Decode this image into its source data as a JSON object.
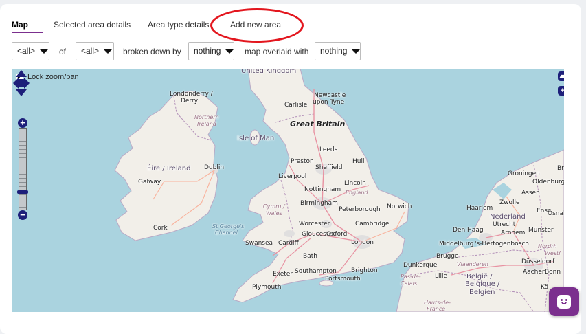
{
  "tabs": [
    {
      "label": "Map",
      "active": true
    },
    {
      "label": "Selected area details",
      "active": false
    },
    {
      "label": "Area type details",
      "active": false
    },
    {
      "label": "Add new area",
      "active": false,
      "highlighted": true
    }
  ],
  "controls": {
    "area_select": "<all>",
    "of_label": "of",
    "area_type_select": "<all>",
    "broken_down_label": "broken down by",
    "breakdown_select": "nothing",
    "overlay_label": "map overlaid with",
    "overlay_select": "nothing"
  },
  "map": {
    "lock_label": "Lock zoom/pan",
    "lock_checked": true,
    "zoom_level_fraction": 0.8,
    "labels": {
      "united_kingdom": "United Kingdom",
      "londonderry": "Londonderry /",
      "derry": "Derry",
      "northern": "Northern",
      "ireland_ni": "Ireland",
      "newcastle": "Newcastle",
      "upon_tyne": "upon Tyne",
      "carlisle": "Carlisle",
      "great_britain": "Great Britain",
      "isle_of_man": "Isle of Man",
      "leeds": "Leeds",
      "preston": "Preston",
      "hull": "Hull",
      "sheffield": "Sheffield",
      "eire": "Éire / Ireland",
      "dublin": "Dublin",
      "liverpool": "Liverpool",
      "galway": "Galway",
      "nottingham": "Nottingham",
      "lincoln": "Lincoln",
      "england": "England",
      "cymru": "Cymru /",
      "wales": "Wales",
      "birmingham": "Birmingham",
      "norwich": "Norwich",
      "peterborough": "Peterborough",
      "cork": "Cork",
      "st_georges": "St George's",
      "channel": "Channel",
      "worcester": "Worcester",
      "cambridge": "Cambridge",
      "gloucester": "Gloucester",
      "oxford": "Oxford",
      "swansea": "Swansea",
      "cardiff": "Cardiff",
      "london": "London",
      "bath": "Bath",
      "exeter": "Exeter",
      "southampton": "Southampton",
      "brighton": "Brighton",
      "plymouth": "Plymouth",
      "portsmouth": "Portsmouth",
      "dunkerque": "Dunkerque",
      "lille": "Lille",
      "pas_de": "Pas-de-",
      "calais": "Calais",
      "hauts_de": "Hauts-de-",
      "france": "France",
      "groningen": "Groningen",
      "oldenburg": "Oldenburg",
      "zwolle": "Zwolle",
      "haarlem": "Haarlem",
      "nederland": "Nederland",
      "den_haag": "Den Haag",
      "utrecht": "Utrecht",
      "arnhem": "Arnhem",
      "munster": "Münster",
      "middelburg": "Middelburg",
      "s_hertogenbosch": "'s-Hertogenbosch",
      "brugge": "Brugge",
      "vlaanderen": "Vlaanderen",
      "dusseldorf": "Düsseldorf",
      "aachen": "Aachen",
      "belgie": "België /",
      "belgique": "Belgique /",
      "belgien": "Belgien",
      "assen": "Assen",
      "enschede": "Ensc",
      "osnab": "Osnab",
      "nordrhein": "Nordrh",
      "westf": "Westf",
      "brem": "Bre",
      "koln": "Kö",
      "bonn": "Bonn"
    }
  },
  "colors": {
    "accent": "#7b2f8e",
    "highlight_ring": "#e3161e",
    "sea": "#aad3df",
    "land": "#f2efe9",
    "control_dark": "#1d1f7a"
  },
  "icons": {
    "lock_checkbox": "checkbox-icon",
    "pan": "pan-arrows-icon",
    "zoom_in": "plus-icon",
    "zoom_out": "minus-icon",
    "layers": "layers-icon",
    "expand": "plus-icon",
    "chat": "chat-smile-icon"
  }
}
